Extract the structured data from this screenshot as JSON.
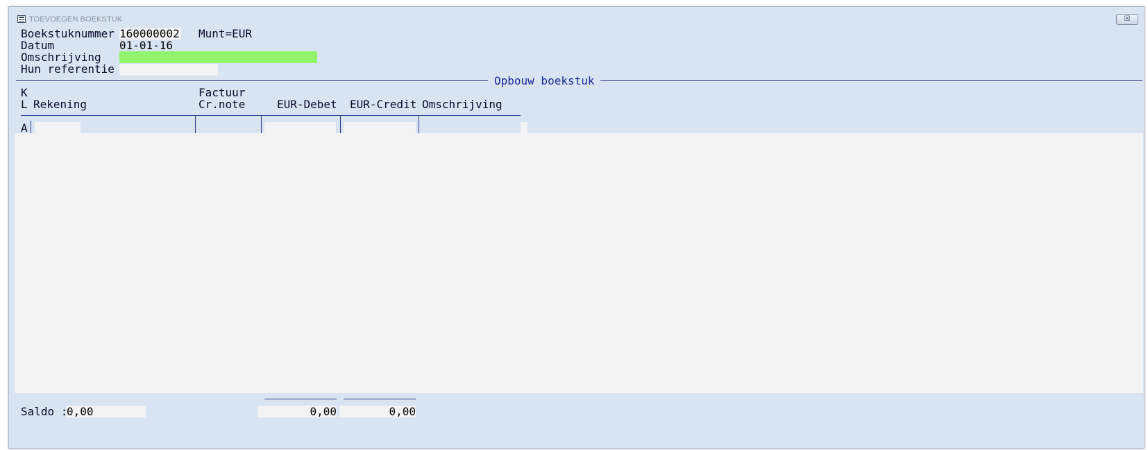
{
  "window": {
    "title": "TOEVOEGEN BOEKSTUK"
  },
  "header": {
    "boekstuknummer_label": "Boekstuknummer",
    "boekstuknummer_value": "160000002",
    "munt": "Munt=EUR",
    "datum_label": "Datum",
    "datum_value": "01-01-16",
    "omschrijving_label": "Omschrijving",
    "omschrijving_value": "",
    "hun_referentie_label": "Hun referentie",
    "hun_referentie_value": ""
  },
  "section": {
    "title": "Opbouw boekstuk"
  },
  "columns": {
    "kl_line1": "K",
    "kl_line2": "L",
    "rekening": "Rekening",
    "factuur_line1": "Factuur",
    "factuur_line2": "Cr.note",
    "eur_debet": "EUR-Debet",
    "eur_credit": "EUR-Credit",
    "omschrijving": "Omschrijving"
  },
  "rows": [
    {
      "kl": "A",
      "rekening": "",
      "factuur": "",
      "debet": "",
      "credit": "",
      "omschrijving": ""
    }
  ],
  "footer": {
    "saldo_label": "Saldo :",
    "saldo_value": "0,00",
    "total_debet": "0,00",
    "total_credit": "0,00"
  },
  "colors": {
    "window_bg": "#d8e4f2",
    "field_bg": "#f3f3f3",
    "active_field_bg": "#92f36c",
    "text_blue": "#1a2a9a"
  }
}
